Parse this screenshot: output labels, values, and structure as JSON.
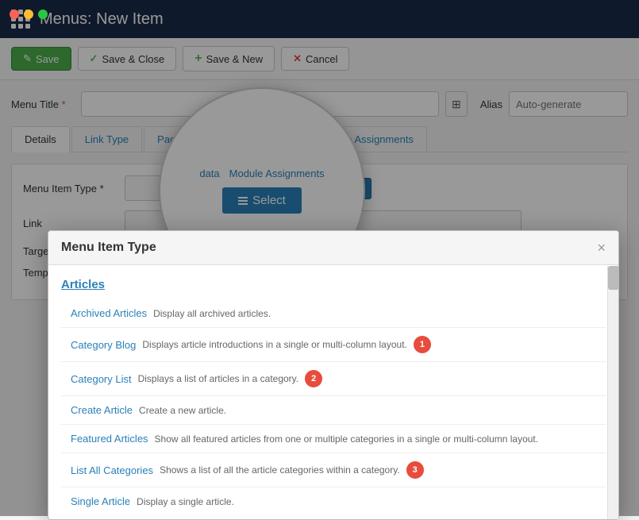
{
  "window": {
    "title": "Menus: New Item"
  },
  "toolbar": {
    "save_label": "Save",
    "save_close_label": "Save & Close",
    "save_new_label": "Save & New",
    "cancel_label": "Cancel"
  },
  "form": {
    "menu_title_label": "Menu Title",
    "menu_title_required": "*",
    "menu_title_value": "",
    "alias_label": "Alias",
    "alias_placeholder": "Auto-generate"
  },
  "tabs": [
    {
      "id": "details",
      "label": "Details",
      "active": true
    },
    {
      "id": "link-type",
      "label": "Link Type",
      "active": false
    },
    {
      "id": "page-display",
      "label": "Page Display",
      "active": false
    },
    {
      "id": "metadata",
      "label": "Metadata",
      "active": false
    },
    {
      "id": "module-assignments",
      "label": "Module Assignments",
      "active": false
    }
  ],
  "fields": {
    "menu_item_type_label": "Menu Item Type *",
    "menu_item_type_value": "",
    "select_button_label": "Select",
    "link_label": "Link",
    "link_value": "",
    "target_label": "Target",
    "template_label": "Template"
  },
  "magnify": {
    "tabs": [
      "data",
      "Module Assignments"
    ],
    "select_label": "Select"
  },
  "modal": {
    "title": "Menu Item Type",
    "close_label": "×",
    "section": "Articles",
    "items": [
      {
        "link": "Archived Articles",
        "desc": "Display all archived articles.",
        "badge": null
      },
      {
        "link": "Category Blog",
        "desc": "Displays article introductions in a single or multi-column layout.",
        "badge": "1"
      },
      {
        "link": "Category List",
        "desc": "Displays a list of articles in a category.",
        "badge": "2"
      },
      {
        "link": "Create Article",
        "desc": "Create a new article.",
        "badge": null
      },
      {
        "link": "Featured Articles",
        "desc": "Show all featured articles from one or multiple categories in a single or multi-column layout.",
        "badge": null
      },
      {
        "link": "List All Categories",
        "desc": "Shows a list of all the article categories within a category.",
        "badge": "3"
      },
      {
        "link": "Single Article",
        "desc": "Display a single article.",
        "badge": null
      }
    ]
  }
}
